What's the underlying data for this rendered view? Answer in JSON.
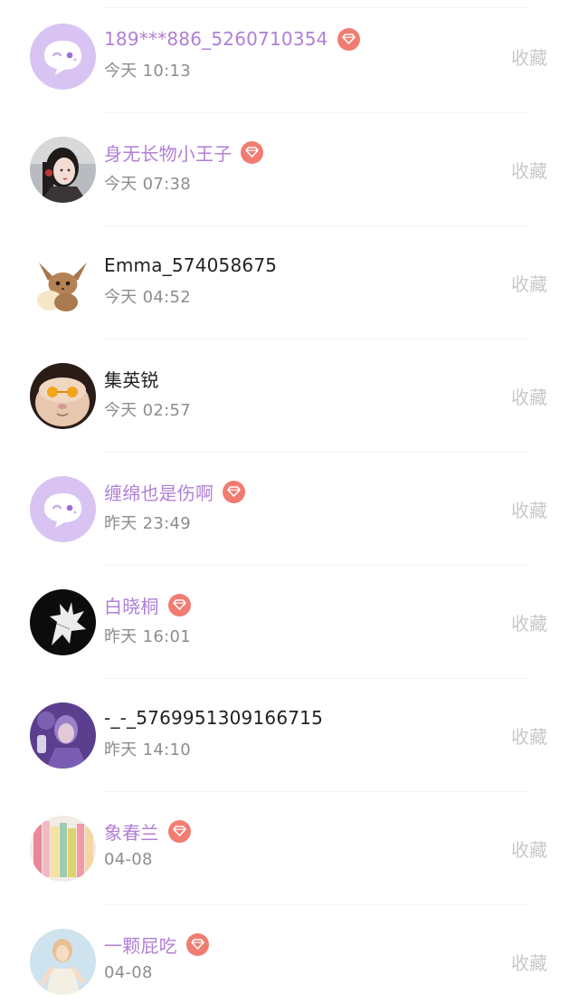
{
  "items": [
    {
      "name": "189***886_5260710354",
      "time": "今天 10:13",
      "vip": true,
      "avatar": "default-chat-bubble-avatar",
      "action": "收藏"
    },
    {
      "name": "身无长物小王子",
      "time": "今天 07:38",
      "vip": true,
      "avatar": "girl-portrait-avatar",
      "action": "收藏"
    },
    {
      "name": "Emma_574058675",
      "time": "今天 04:52",
      "vip": false,
      "avatar": "eevee-avatar",
      "action": "收藏"
    },
    {
      "name": "集英锐",
      "time": "今天 02:57",
      "vip": false,
      "avatar": "cat-with-glasses-avatar",
      "action": "收藏"
    },
    {
      "name": "缠绵也是伤啊",
      "time": "昨天 23:49",
      "vip": true,
      "avatar": "default-chat-bubble-avatar",
      "action": "收藏"
    },
    {
      "name": "白晓桐",
      "time": "昨天 16:01",
      "vip": true,
      "avatar": "white-leaf-dark-avatar",
      "action": "收藏"
    },
    {
      "name": "-_-_5769951309166715",
      "time": "昨天 14:10",
      "vip": false,
      "avatar": "purple-portrait-avatar",
      "action": "收藏"
    },
    {
      "name": "象春兰",
      "time": "04-08",
      "vip": true,
      "avatar": "colored-books-avatar",
      "action": "收藏"
    },
    {
      "name": "一颗屁吃",
      "time": "04-08",
      "vip": true,
      "avatar": "woman-in-light-avatar",
      "action": "收藏"
    }
  ],
  "colors": {
    "vip_name": "#b07fd6",
    "normal_name": "#222222",
    "vip_badge": "#f07c72",
    "time": "#8d8d8d",
    "action": "#c8c8c8"
  }
}
